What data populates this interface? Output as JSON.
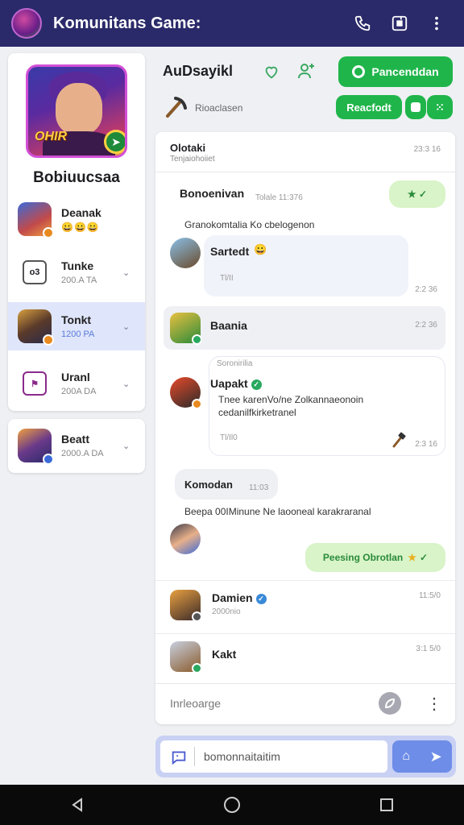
{
  "app": {
    "title": "Komunitans Game:"
  },
  "colors": {
    "topbar": "#2a2a6a",
    "accent_green": "#1fb54a",
    "active_item": "#dfe6fb",
    "composer": "#c8d0f4"
  },
  "left": {
    "hero_text": "OHIR",
    "hero_name": "Bobiuucsaa",
    "items": [
      {
        "name": "Deanak",
        "sub": "😀😀😀",
        "icon": "game-avatar"
      },
      {
        "name": "Tunke",
        "sub": "200.A TA",
        "icon": "controller-outline-icon"
      },
      {
        "name": "Tonkt",
        "sub": "1200 PA",
        "icon": "game-avatar"
      },
      {
        "name": "Uranl",
        "sub": "200A DA",
        "icon": "bag-outline-icon"
      }
    ],
    "card2": {
      "name": "Beatt",
      "sub": "2000.A DA"
    }
  },
  "header": {
    "title": "AuDsayikl",
    "primary_button": "Pancenddan",
    "secondary_button": "Reacfodt",
    "subtitle": "Rioaclasen"
  },
  "chat": {
    "head": {
      "title": "Olotaki",
      "subtitle": "Tenjaiohoiiet",
      "time": "23:3 16"
    },
    "m1": {
      "name": "Bonoenivan",
      "meta": "Tolale 11:376",
      "reaction": "★ ✓",
      "text": "Granokomtalia Ko cbelogenon"
    },
    "m2": {
      "name": "Sartedt",
      "emoji": "😀",
      "sub": "Tl/II",
      "time": "2:2 36"
    },
    "m3": {
      "name": "Baania",
      "time": "2:2 36"
    },
    "m4": {
      "label": "Soronirilia",
      "name": "Uapakt",
      "text": "Tnee karenVo/ne Zolkannaeonoin cedanilfkirketranel",
      "sub": "Tl/Il0",
      "time": "2:3 16"
    },
    "m5": {
      "title": "Komodan",
      "meta": "11:03",
      "text": "Beepa 00IMinune Ne laooneal karakraranal",
      "bubble": "Peesing Obrotlan"
    },
    "m6": {
      "name": "Damien",
      "sub": "2000nio",
      "time": "11:5/0"
    },
    "m7": {
      "name": "Kakt",
      "time": "3:1 5/0"
    },
    "input_placeholder": "Inrleoarge"
  },
  "composer": {
    "placeholder": "bomonnaitaitim"
  }
}
